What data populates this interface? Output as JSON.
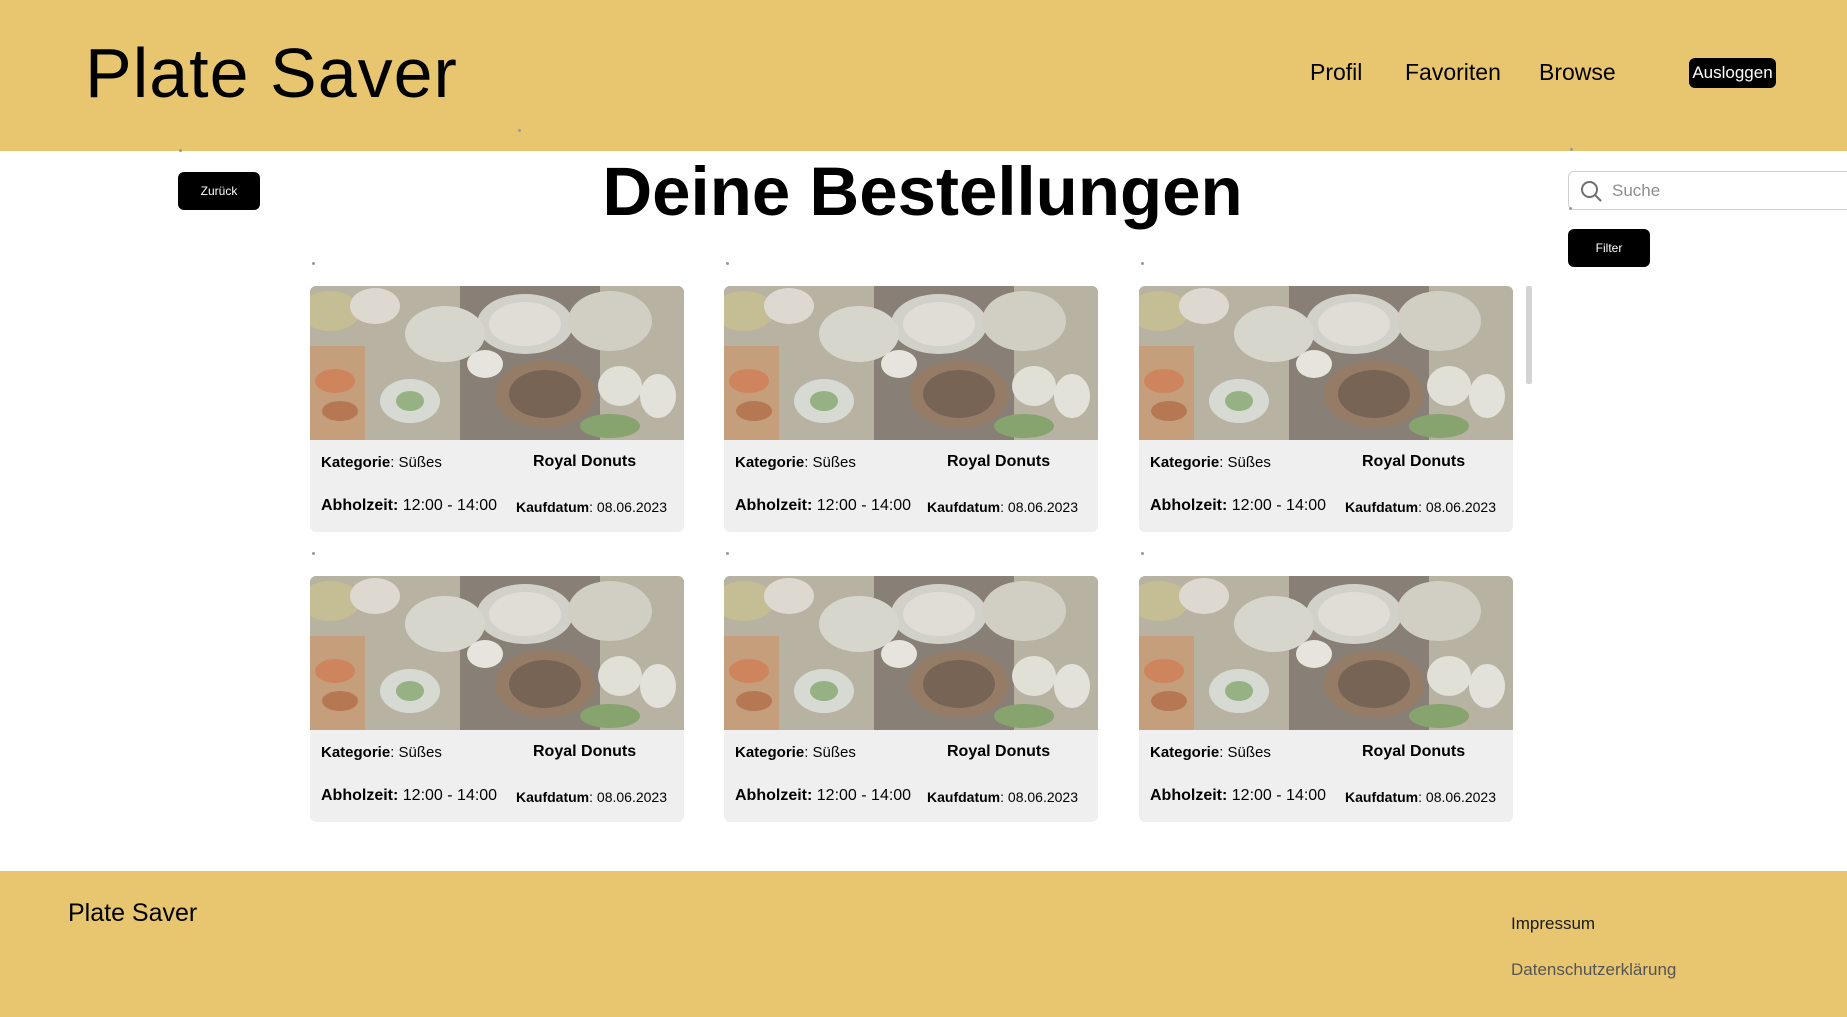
{
  "header": {
    "brand": "Plate Saver",
    "nav": [
      {
        "label": "Profil"
      },
      {
        "label": "Favoriten"
      },
      {
        "label": "Browse"
      }
    ],
    "logout_label": "Ausloggen"
  },
  "main": {
    "back_label": "Zurück",
    "title": "Deine Bestellungen",
    "search_placeholder": "Suche",
    "filter_label": "Filter",
    "orders": [
      {
        "category_label": "Kategorie",
        "category": "Süßes",
        "name": "Royal Donuts",
        "pickup_label": "Abholzeit:",
        "pickup": "12:00 - 14:00",
        "date_label": "Kaufdatum",
        "date": "08.06.2023"
      },
      {
        "category_label": "Kategorie",
        "category": "Süßes",
        "name": "Royal Donuts",
        "pickup_label": "Abholzeit:",
        "pickup": "12:00 - 14:00",
        "date_label": "Kaufdatum",
        "date": "08.06.2023"
      },
      {
        "category_label": "Kategorie",
        "category": "Süßes",
        "name": "Royal Donuts",
        "pickup_label": "Abholzeit:",
        "pickup": "12:00 - 14:00",
        "date_label": "Kaufdatum",
        "date": "08.06.2023"
      },
      {
        "category_label": "Kategorie",
        "category": "Süßes",
        "name": "Royal Donuts",
        "pickup_label": "Abholzeit:",
        "pickup": "12:00 - 14:00",
        "date_label": "Kaufdatum",
        "date": "08.06.2023"
      },
      {
        "category_label": "Kategorie",
        "category": "Süßes",
        "name": "Royal Donuts",
        "pickup_label": "Abholzeit:",
        "pickup": "12:00 - 14:00",
        "date_label": "Kaufdatum",
        "date": "08.06.2023"
      },
      {
        "category_label": "Kategorie",
        "category": "Süßes",
        "name": "Royal Donuts",
        "pickup_label": "Abholzeit:",
        "pickup": "12:00 - 14:00",
        "date_label": "Kaufdatum",
        "date": "08.06.2023"
      }
    ]
  },
  "footer": {
    "brand": "Plate Saver",
    "links": [
      {
        "label": "Impressum"
      },
      {
        "label": "Datenschutzerklärung"
      }
    ]
  },
  "colors": {
    "brand_yellow": "#E8C670",
    "button_black": "#000000",
    "card_background": "#EFEFEF"
  },
  "icons": {
    "search": "search-icon",
    "card_image": "food-table-image"
  }
}
